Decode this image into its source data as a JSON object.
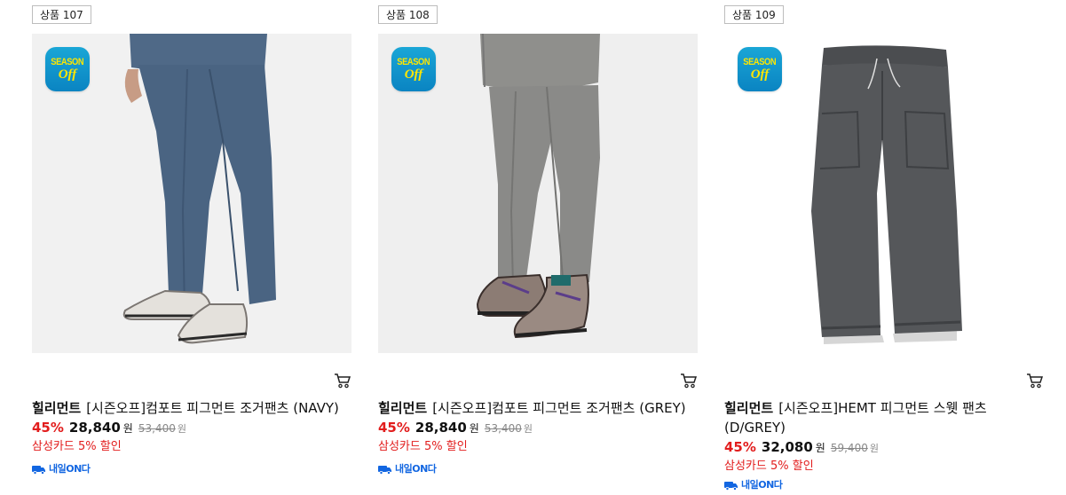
{
  "products": [
    {
      "rank": "상품 107",
      "brand": "힐리먼트",
      "name": "[시즌오프]컴포트 피그먼트 조거팬츠 (NAVY)",
      "discount_rate": "45%",
      "sale_price": "28,840",
      "currency": "원",
      "original_price": "53,400",
      "original_currency": "원",
      "card_discount": "삼성카드 5% 할인",
      "delivery_label": "내일ON다",
      "season_badge_top": "SEASON",
      "season_badge_bottom": "Off",
      "color": "#4a6482"
    },
    {
      "rank": "상품 108",
      "brand": "힐리먼트",
      "name": "[시즌오프]컴포트 피그먼트 조거팬츠 (GREY)",
      "discount_rate": "45%",
      "sale_price": "28,840",
      "currency": "원",
      "original_price": "53,400",
      "original_currency": "원",
      "card_discount": "삼성카드 5% 할인",
      "delivery_label": "내일ON다",
      "season_badge_top": "SEASON",
      "season_badge_bottom": "Off",
      "color": "#8a8a88"
    },
    {
      "rank": "상품 109",
      "brand": "힐리먼트",
      "name": "[시즌오프]HEMT 피그먼트 스웻 팬츠 (D/GREY)",
      "discount_rate": "45%",
      "sale_price": "32,080",
      "currency": "원",
      "original_price": "59,400",
      "original_currency": "원",
      "card_discount": "삼성카드 5% 할인",
      "delivery_label": "내일ON다",
      "season_badge_top": "SEASON",
      "season_badge_bottom": "Off",
      "color": "#55575a"
    }
  ]
}
